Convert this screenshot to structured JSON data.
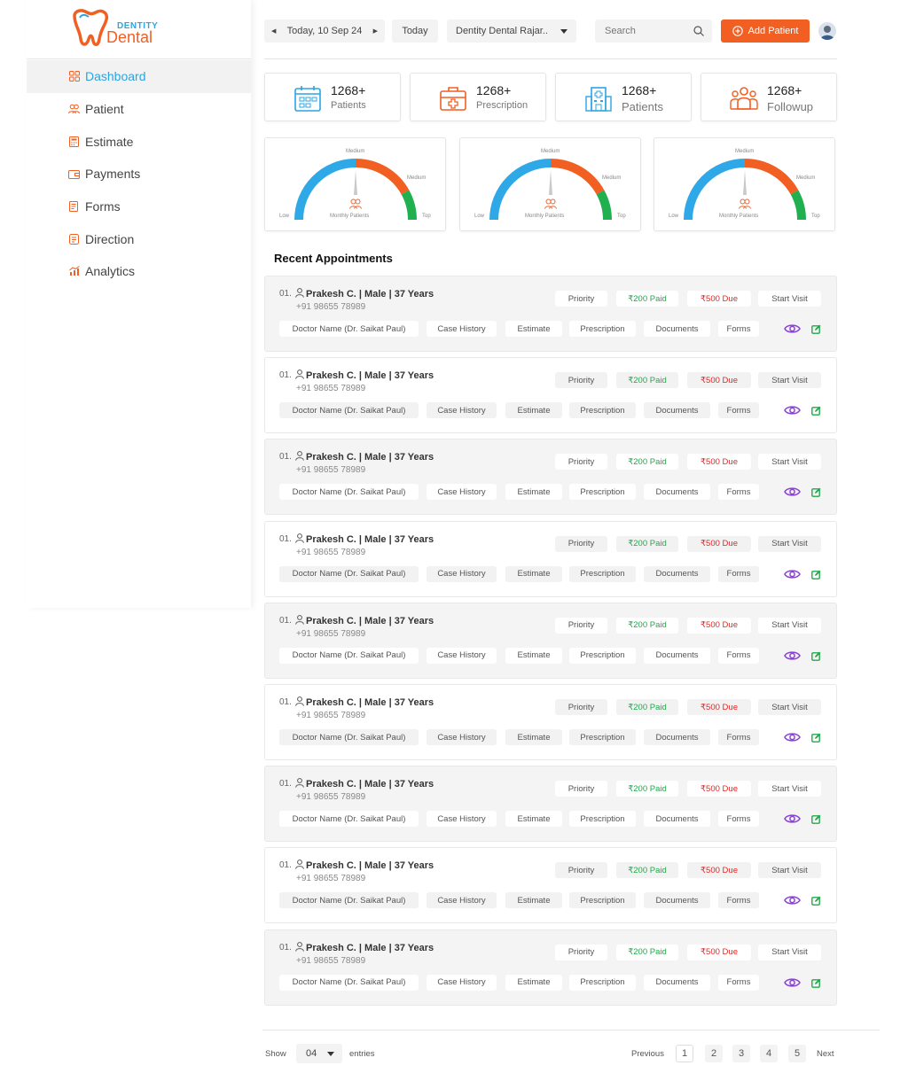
{
  "brand": {
    "top": "DENTITY",
    "main": "Dental",
    "orange": "#f25f22",
    "blue": "#2ba6e0"
  },
  "sidebar": {
    "items": [
      {
        "label": "Dashboard",
        "icon": "grid-icon",
        "active": true
      },
      {
        "label": "Patient",
        "icon": "users-icon"
      },
      {
        "label": "Estimate",
        "icon": "calculator-icon"
      },
      {
        "label": "Payments",
        "icon": "wallet-icon"
      },
      {
        "label": "Forms",
        "icon": "form-icon"
      },
      {
        "label": "Direction",
        "icon": "direction-icon"
      },
      {
        "label": "Analytics",
        "icon": "analytics-icon"
      }
    ]
  },
  "topbar": {
    "date": "Today, 10 Sep 24",
    "today": "Today",
    "clinic": "Dentity Dental Rajar..",
    "search_placeholder": "Search",
    "add_patient": "Add Patient"
  },
  "stats": [
    {
      "value": "1268+",
      "label": "Patients"
    },
    {
      "value": "1268+",
      "label": "Prescription"
    },
    {
      "value": "1268+",
      "label": "Patients"
    },
    {
      "value": "1268+",
      "label": "Followup"
    }
  ],
  "gauges": [
    {
      "top": "Medium",
      "right": "Medium",
      "low": "Low",
      "high": "Top",
      "caption": "Monthly Patients"
    },
    {
      "top": "Medium",
      "right": "Medium",
      "low": "Low",
      "high": "Top",
      "caption": "Monthly Patients"
    },
    {
      "top": "Medium",
      "right": "Medium",
      "low": "Low",
      "high": "Top",
      "caption": "Monthly Patients"
    }
  ],
  "appointments": {
    "title": "Recent Appointments",
    "rows": [
      {
        "num": "01.",
        "name": "Prakesh C. | Male | 37 Years",
        "phone": "+91 98655 78989",
        "priority": "Priority",
        "paid": "₹200 Paid",
        "due": "₹500 Due",
        "start": "Start Visit",
        "doctor": "Doctor Name (Dr. Saikat Paul)",
        "case": "Case History",
        "estimate": "Estimate",
        "prescription": "Prescription",
        "documents": "Documents",
        "forms": "Forms"
      },
      {
        "num": "01.",
        "name": "Prakesh C. | Male | 37 Years",
        "phone": "+91 98655 78989",
        "priority": "Priority",
        "paid": "₹200 Paid",
        "due": "₹500 Due",
        "start": "Start Visit",
        "doctor": "Doctor Name (Dr. Saikat Paul)",
        "case": "Case History",
        "estimate": "Estimate",
        "prescription": "Prescription",
        "documents": "Documents",
        "forms": "Forms"
      },
      {
        "num": "01.",
        "name": "Prakesh C. | Male | 37 Years",
        "phone": "+91 98655 78989",
        "priority": "Priority",
        "paid": "₹200 Paid",
        "due": "₹500 Due",
        "start": "Start Visit",
        "doctor": "Doctor Name (Dr. Saikat Paul)",
        "case": "Case History",
        "estimate": "Estimate",
        "prescription": "Prescription",
        "documents": "Documents",
        "forms": "Forms"
      },
      {
        "num": "01.",
        "name": "Prakesh C. | Male | 37 Years",
        "phone": "+91 98655 78989",
        "priority": "Priority",
        "paid": "₹200 Paid",
        "due": "₹500 Due",
        "start": "Start Visit",
        "doctor": "Doctor Name (Dr. Saikat Paul)",
        "case": "Case History",
        "estimate": "Estimate",
        "prescription": "Prescription",
        "documents": "Documents",
        "forms": "Forms"
      },
      {
        "num": "01.",
        "name": "Prakesh C. | Male | 37 Years",
        "phone": "+91 98655 78989",
        "priority": "Priority",
        "paid": "₹200 Paid",
        "due": "₹500 Due",
        "start": "Start Visit",
        "doctor": "Doctor Name (Dr. Saikat Paul)",
        "case": "Case History",
        "estimate": "Estimate",
        "prescription": "Prescription",
        "documents": "Documents",
        "forms": "Forms"
      },
      {
        "num": "01.",
        "name": "Prakesh C. | Male | 37 Years",
        "phone": "+91 98655 78989",
        "priority": "Priority",
        "paid": "₹200 Paid",
        "due": "₹500 Due",
        "start": "Start Visit",
        "doctor": "Doctor Name (Dr. Saikat Paul)",
        "case": "Case History",
        "estimate": "Estimate",
        "prescription": "Prescription",
        "documents": "Documents",
        "forms": "Forms"
      },
      {
        "num": "01.",
        "name": "Prakesh C. | Male | 37 Years",
        "phone": "+91 98655 78989",
        "priority": "Priority",
        "paid": "₹200 Paid",
        "due": "₹500 Due",
        "start": "Start Visit",
        "doctor": "Doctor Name (Dr. Saikat Paul)",
        "case": "Case History",
        "estimate": "Estimate",
        "prescription": "Prescription",
        "documents": "Documents",
        "forms": "Forms"
      },
      {
        "num": "01.",
        "name": "Prakesh C. | Male | 37 Years",
        "phone": "+91 98655 78989",
        "priority": "Priority",
        "paid": "₹200 Paid",
        "due": "₹500 Due",
        "start": "Start Visit",
        "doctor": "Doctor Name (Dr. Saikat Paul)",
        "case": "Case History",
        "estimate": "Estimate",
        "prescription": "Prescription",
        "documents": "Documents",
        "forms": "Forms"
      },
      {
        "num": "01.",
        "name": "Prakesh C. | Male | 37 Years",
        "phone": "+91 98655 78989",
        "priority": "Priority",
        "paid": "₹200 Paid",
        "due": "₹500 Due",
        "start": "Start Visit",
        "doctor": "Doctor Name (Dr. Saikat Paul)",
        "case": "Case History",
        "estimate": "Estimate",
        "prescription": "Prescription",
        "documents": "Documents",
        "forms": "Forms"
      }
    ]
  },
  "pagination": {
    "show": "Show",
    "entries_value": "04",
    "entries": "entries",
    "previous": "Previous",
    "next": "Next",
    "pages": [
      "1",
      "2",
      "3",
      "4",
      "5"
    ],
    "current": "1"
  }
}
